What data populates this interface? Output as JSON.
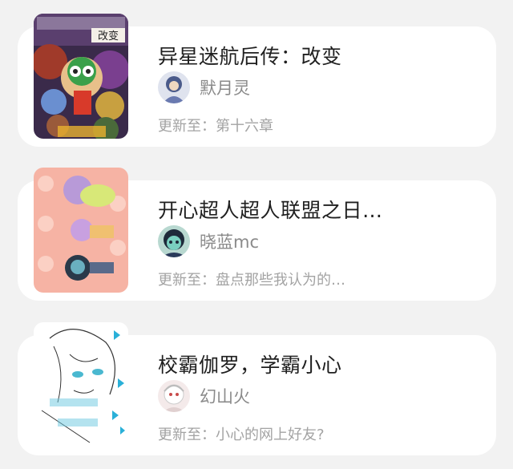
{
  "books": [
    {
      "title": "异星迷航后传：改变",
      "author": "默月灵",
      "update": "更新至：第十六章",
      "cover_icon": "cover-book-1",
      "cover_text": "改变"
    },
    {
      "title": "开心超人超人联盟之日…",
      "author": "晓蓝mc",
      "update": "更新至：盘点那些我认为的…",
      "cover_icon": "cover-book-2"
    },
    {
      "title": "校霸伽罗，学霸小心",
      "author": "幻山火",
      "update": "更新至：小心的网上好友?",
      "cover_icon": "cover-book-3"
    }
  ],
  "colors": {
    "background": "#f2f2f2",
    "card": "#ffffff",
    "title": "#1f1f1f",
    "author": "#8a8a8a",
    "update": "#a3a3a3"
  }
}
